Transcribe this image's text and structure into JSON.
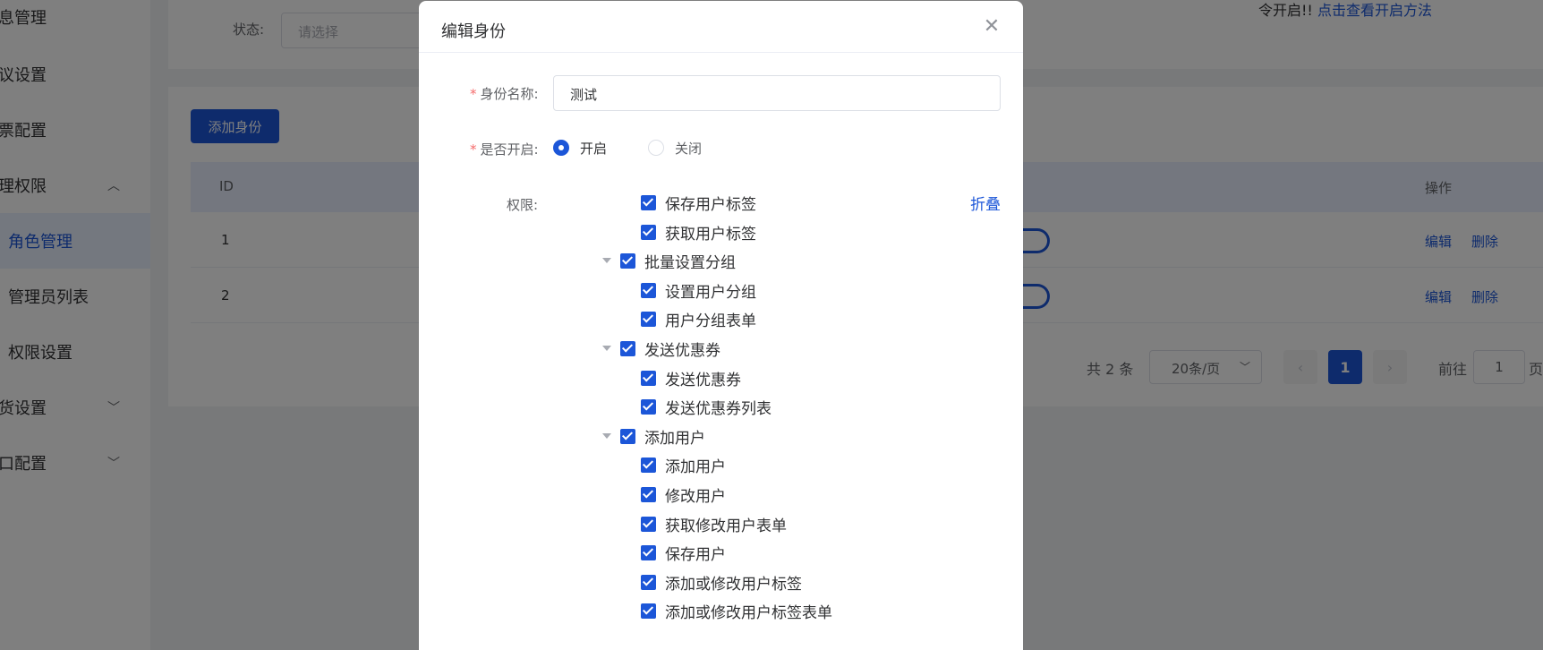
{
  "sidebar": {
    "items": [
      {
        "label": "息管理"
      },
      {
        "label": "议设置"
      },
      {
        "label": "票配置"
      },
      {
        "label": "理权限"
      },
      {
        "label": "角色管理"
      },
      {
        "label": "管理员列表"
      },
      {
        "label": "权限设置"
      },
      {
        "label": "货设置"
      },
      {
        "label": "口配置"
      }
    ]
  },
  "filter": {
    "status_label": "状态:",
    "status_placeholder": "请选择"
  },
  "notice": {
    "text": "令开启!!",
    "link": "点击查看开启方法"
  },
  "toolbar": {
    "add_label": "添加身份"
  },
  "table": {
    "columns": {
      "id": "ID",
      "actions": "操作"
    },
    "rows": [
      {
        "id": "1",
        "edit": "编辑",
        "delete": "删除"
      },
      {
        "id": "2",
        "edit": "编辑",
        "delete": "删除"
      }
    ]
  },
  "pagination": {
    "total": "共 2 条",
    "page_size": "20条/页",
    "current_page": "1",
    "goto_prefix": "前往",
    "goto_value": "1",
    "goto_suffix": "页"
  },
  "dialog": {
    "title": "编辑身份",
    "name_label": "身份名称:",
    "name_value": "测试",
    "enabled_label": "是否开启:",
    "enabled_on": "开启",
    "enabled_off": "关闭",
    "enabled_value": "开启",
    "permissions_label": "权限:",
    "collapse_label": "折叠",
    "tree": [
      {
        "label": "保存用户标签",
        "level": 2,
        "checked": true
      },
      {
        "label": "获取用户标签",
        "level": 2,
        "checked": true
      },
      {
        "label": "批量设置分组",
        "level": 1,
        "checked": true,
        "expanded": true
      },
      {
        "label": "设置用户分组",
        "level": 2,
        "checked": true
      },
      {
        "label": "用户分组表单",
        "level": 2,
        "checked": true
      },
      {
        "label": "发送优惠券",
        "level": 1,
        "checked": true,
        "expanded": true
      },
      {
        "label": "发送优惠券",
        "level": 2,
        "checked": true
      },
      {
        "label": "发送优惠券列表",
        "level": 2,
        "checked": true
      },
      {
        "label": "添加用户",
        "level": 1,
        "checked": true,
        "expanded": true
      },
      {
        "label": "添加用户",
        "level": 2,
        "checked": true
      },
      {
        "label": "修改用户",
        "level": 2,
        "checked": true
      },
      {
        "label": "获取修改用户表单",
        "level": 2,
        "checked": true
      },
      {
        "label": "保存用户",
        "level": 2,
        "checked": true
      },
      {
        "label": "添加或修改用户标签",
        "level": 2,
        "checked": true
      },
      {
        "label": "添加或修改用户标签表单",
        "level": 2,
        "checked": true
      }
    ]
  },
  "colors": {
    "primary": "#1c56d8",
    "required": "#f56c6c",
    "overlay": "rgba(0,0,0,0.5)"
  }
}
